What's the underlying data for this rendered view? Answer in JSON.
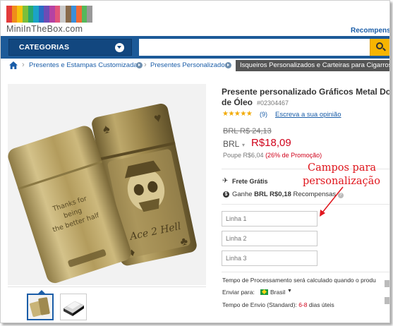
{
  "header": {
    "logo_text": "MiniInTheBox.com",
    "rewards_link": "Recompensa",
    "logo_colors": [
      "#e23b3b",
      "#f08c1b",
      "#f4c20d",
      "#7cbf3a",
      "#2aa86c",
      "#1ba3c7",
      "#2a6cc4",
      "#6d4cb5",
      "#b542a3",
      "#e2557a",
      "#c9c9c9",
      "#8a6a4a",
      "#3b8fd9",
      "#f06a35",
      "#55b85a",
      "#999999"
    ]
  },
  "navbar": {
    "categories_label": "CATEGORIAS",
    "search_placeholder": "",
    "search_icon": "search-icon"
  },
  "breadcrumb": {
    "items": [
      "Presentes e Estampas Customizadas",
      "Presentes Personalizados"
    ],
    "current": "Isqueiros Personalizados e Carteiras para Cigarros"
  },
  "product": {
    "title_line1": "Presente personalizado Gráficos Metal Do",
    "title_line2": "de Óleo",
    "sku": "#02304467",
    "rating": 5,
    "stars": "★★★★★",
    "review_count": "(9)",
    "review_link": "Escreva a sua opinião",
    "old_price": "BRL R$ 24,13",
    "currency": "BRL",
    "price": "R$18,09",
    "savings_prefix": "Poupe R$6,04",
    "savings_promo": "(26% de Promoção)",
    "shipping": "Frete Grátis",
    "reward_prefix": "Ganhe",
    "reward_amount": "BRL R$0,18",
    "reward_suffix": "Recompensas",
    "line_inputs": [
      "Linha 1",
      "Linha 2",
      "Linha 3"
    ],
    "processing_text": "Tempo de Processamento será calculado quando o produ",
    "send_to_label": "Enviar para:",
    "send_to_country": "Brasil",
    "delivery_prefix": "Tempo de Envio (Standard):",
    "delivery_days": "6-8",
    "delivery_suffix": "dias úteis"
  },
  "image": {
    "engraving_lines": [
      "Thanks for",
      "being",
      "the better half"
    ],
    "thumbnails": 2,
    "active_thumbnail": 1
  },
  "annotation": {
    "line1": "Campos para",
    "line2": "personalização",
    "color": "#e0161d"
  }
}
